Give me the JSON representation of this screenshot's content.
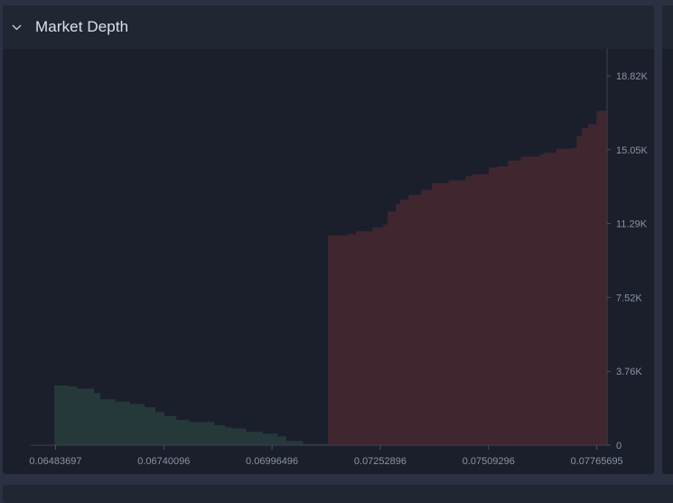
{
  "panel": {
    "title": "Market Depth",
    "chevron_icon": "chevron-down-icon"
  },
  "colors": {
    "bid_fill": "#26393a",
    "ask_fill": "#40262f",
    "background": "#1b1f2b",
    "header": "#202733",
    "tick_text": "#8a93a6"
  },
  "chart_data": {
    "type": "area",
    "title": "",
    "xlabel": "",
    "ylabel": "",
    "x_ticks": [
      "0.06483697",
      "0.06740096",
      "0.06996496",
      "0.07252896",
      "0.07509296",
      "0.07765695"
    ],
    "x_tick_values": [
      0.06483697,
      0.06740096,
      0.06996496,
      0.07252896,
      0.07509296,
      0.07765695
    ],
    "y_ticks": [
      "0",
      "3.76K",
      "7.52K",
      "11.29K",
      "15.05K",
      "18.82K"
    ],
    "y_tick_values": [
      0,
      3763,
      7526,
      11290,
      15053,
      18816
    ],
    "xlim": [
      0.06483697,
      0.07765695
    ],
    "ylim": [
      0,
      18816
    ],
    "grid": false,
    "series": [
      {
        "side": "bid",
        "x": [
          0.06481,
          0.06515,
          0.06535,
          0.06575,
          0.0659,
          0.06625,
          0.0666,
          0.06695,
          0.0672,
          0.06742,
          0.0677,
          0.068,
          0.0686,
          0.06885,
          0.069,
          0.06935,
          0.06975,
          0.0701,
          0.0703,
          0.0707,
          0.07128
        ],
        "y": [
          3040,
          2990,
          2880,
          2650,
          2340,
          2220,
          2100,
          1930,
          1690,
          1480,
          1290,
          1180,
          1010,
          900,
          850,
          680,
          590,
          450,
          220,
          60,
          0
        ]
      },
      {
        "side": "ask",
        "x": [
          0.07129,
          0.07175,
          0.07195,
          0.07235,
          0.0726,
          0.0727,
          0.0729,
          0.073,
          0.0732,
          0.0735,
          0.07375,
          0.07415,
          0.07455,
          0.0747,
          0.0751,
          0.0753,
          0.07555,
          0.07585,
          0.0763,
          0.0764,
          0.0767,
          0.07705,
          0.07718,
          0.0773,
          0.07745,
          0.07765
        ],
        "y": [
          10680,
          10750,
          10900,
          11100,
          11250,
          11900,
          12300,
          12500,
          12750,
          13000,
          13350,
          13500,
          13700,
          13800,
          14150,
          14200,
          14500,
          14700,
          14800,
          14900,
          15100,
          15150,
          15750,
          16150,
          16350,
          17030
        ]
      }
    ]
  }
}
